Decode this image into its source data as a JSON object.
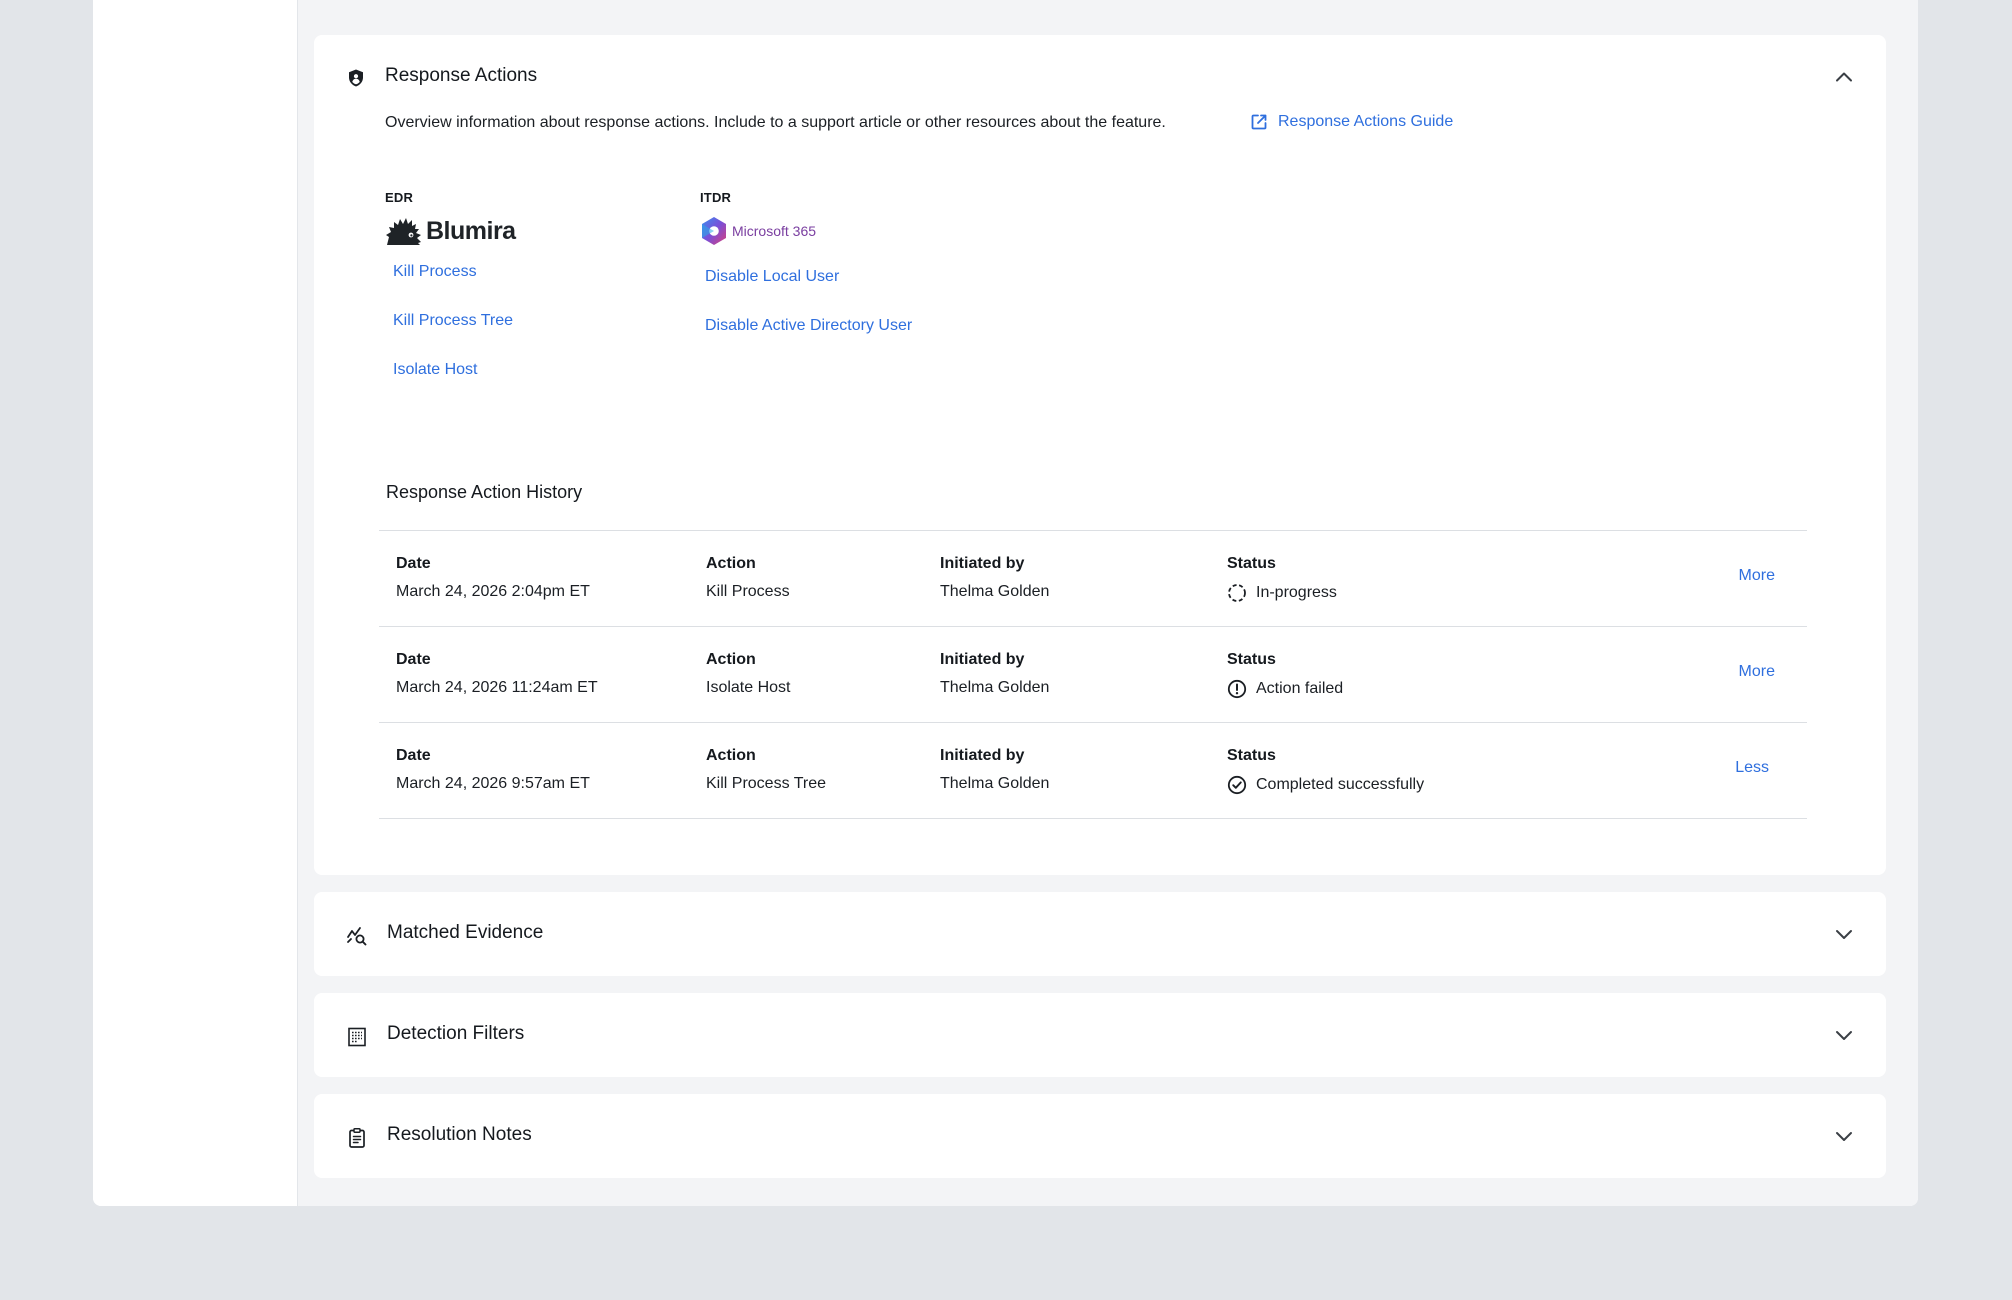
{
  "colors": {
    "page_bg": "#e2e5e9",
    "content_bg": "#f3f4f6",
    "card_bg": "#ffffff",
    "link": "#2f6fde",
    "text": "#1b1f24",
    "microsoft_purple": "#7a3ea0"
  },
  "response_actions": {
    "title": "Response Actions",
    "icon": "shield-icon",
    "expanded": true,
    "intro": "Overview information about response actions. Include to a support article or other resources about the feature.",
    "guide_link": "Response Actions Guide",
    "guide_icon": "external-link-icon",
    "edr": {
      "label": "EDR",
      "vendor": "Blumira",
      "actions": [
        "Kill Process",
        "Kill Process Tree",
        "Isolate Host"
      ]
    },
    "itdr": {
      "label": "ITDR",
      "vendor": "Microsoft 365",
      "actions": [
        "Disable Local User",
        "Disable Active Directory User"
      ]
    },
    "history": {
      "title": "Response Action History",
      "headers": {
        "date": "Date",
        "action": "Action",
        "initiated_by": "Initiated by",
        "status": "Status"
      },
      "rows": [
        {
          "date": "March 24, 2026 2:04pm ET",
          "action": "Kill Process",
          "initiated_by": "Thelma Golden",
          "status": "In-progress",
          "status_icon": "spinner-icon",
          "toggle": "More"
        },
        {
          "date": "March 24, 2026 11:24am ET",
          "action": "Isolate Host",
          "initiated_by": "Thelma Golden",
          "status": "Action failed",
          "status_icon": "alert-circle-icon",
          "toggle": "More"
        },
        {
          "date": "March 24, 2026 9:57am ET",
          "action": "Kill Process Tree",
          "initiated_by": "Thelma Golden",
          "status": "Completed successfully",
          "status_icon": "check-circle-icon",
          "toggle": "Less"
        }
      ]
    }
  },
  "sections": [
    {
      "title": "Matched Evidence",
      "icon": "chart-search-icon",
      "expanded": false
    },
    {
      "title": "Detection Filters",
      "icon": "filter-list-icon",
      "expanded": false
    },
    {
      "title": "Resolution Notes",
      "icon": "clipboard-icon",
      "expanded": false
    }
  ]
}
